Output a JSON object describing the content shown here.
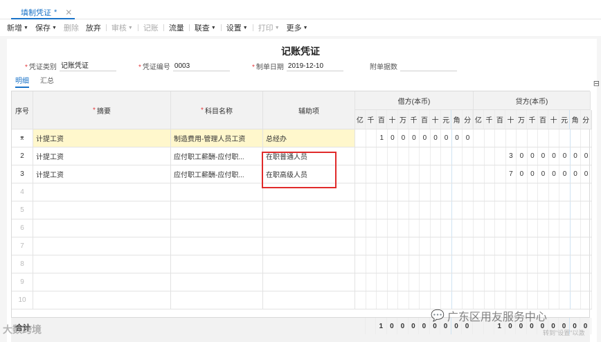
{
  "tab": {
    "label": "填制凭证",
    "modified_mark": "*",
    "close": "✕"
  },
  "toolbar": [
    {
      "label": "新增",
      "caret": true,
      "disabled": false,
      "sep_before": false
    },
    {
      "label": "保存",
      "caret": true,
      "disabled": false,
      "sep_before": false
    },
    {
      "label": "删除",
      "caret": false,
      "disabled": true,
      "sep_before": false
    },
    {
      "label": "放弃",
      "caret": false,
      "disabled": false,
      "sep_before": false
    },
    {
      "label": "审核",
      "caret": true,
      "disabled": true,
      "sep_before": true
    },
    {
      "label": "记账",
      "caret": false,
      "disabled": true,
      "sep_before": true
    },
    {
      "label": "流量",
      "caret": false,
      "disabled": false,
      "sep_before": true
    },
    {
      "label": "联查",
      "caret": true,
      "disabled": false,
      "sep_before": true
    },
    {
      "label": "设置",
      "caret": true,
      "disabled": false,
      "sep_before": true
    },
    {
      "label": "打印",
      "caret": true,
      "disabled": true,
      "sep_before": true
    },
    {
      "label": "更多",
      "caret": true,
      "disabled": false,
      "sep_before": false
    }
  ],
  "voucher": {
    "title": "记账凭证",
    "type_label": "凭证类别",
    "type_value": "记账凭证",
    "number_label": "凭证编号",
    "number_value": "0003",
    "date_label": "制单日期",
    "date_value": "2019-12-10",
    "attach_label": "附单据数",
    "attach_value": ""
  },
  "subtabs": [
    "明细",
    "汇总"
  ],
  "grid": {
    "headers": {
      "seq": "序号",
      "summary": "摘要",
      "account": "科目名称",
      "aux": "辅助项",
      "debit": "借方(本币)",
      "credit": "贷方(本币)"
    },
    "digit_units": [
      "亿",
      "千",
      "百",
      "十",
      "万",
      "千",
      "百",
      "十",
      "元",
      "角",
      "分"
    ],
    "rows": [
      {
        "seq": "⌆",
        "summary": "计提工资",
        "account": "制造费用-管理人员工资",
        "aux": "总经办",
        "debit": "1000000.00",
        "credit": ""
      },
      {
        "seq": "2",
        "summary": "计提工资",
        "account": "应付职工薪酬-应付职...",
        "aux": "在职普通人员",
        "debit": "",
        "credit": "300000.00"
      },
      {
        "seq": "3",
        "summary": "计提工资",
        "account": "应付职工薪酬-应付职...",
        "aux": "在职高级人员",
        "debit": "",
        "credit": "700000.00"
      },
      {
        "seq": "4"
      },
      {
        "seq": "5"
      },
      {
        "seq": "6"
      },
      {
        "seq": "7"
      },
      {
        "seq": "8"
      },
      {
        "seq": "9"
      },
      {
        "seq": "10"
      }
    ],
    "totals": {
      "label": "合计",
      "debit": "1000000.00",
      "credit": "1000000.00"
    }
  },
  "watermarks": {
    "left": "大数跨境",
    "right": "广东区用友服务中心",
    "right_sub": "转到\"设置\"以激"
  }
}
